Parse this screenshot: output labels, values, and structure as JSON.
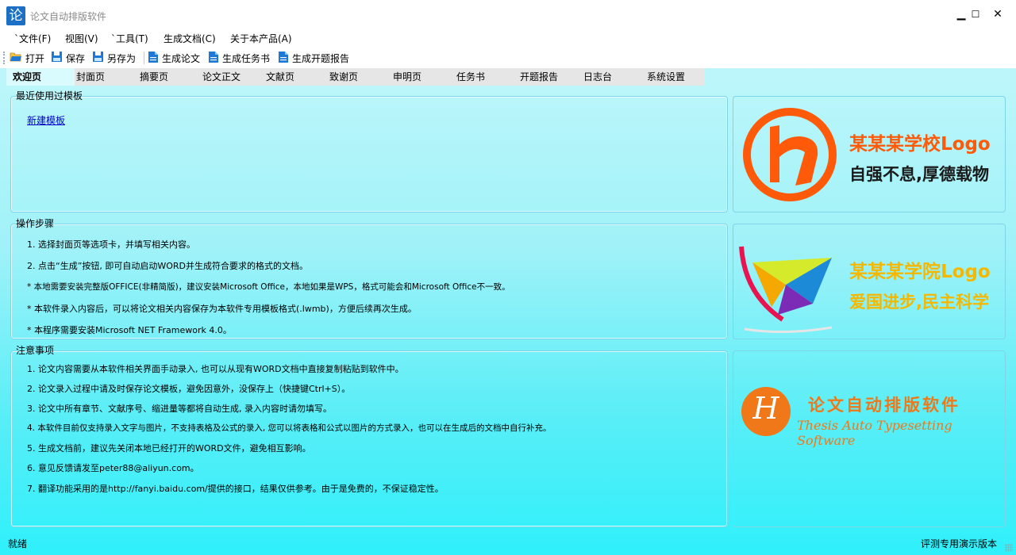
{
  "window": {
    "title": "论文自动排版软件",
    "icon_glyph": "论",
    "icon_color": "#1b6fc4",
    "controls": {
      "minimize": "▁",
      "maximize": "☐",
      "close": "✕"
    }
  },
  "menubar": {
    "items": [
      "`文件(F)",
      "视图(V)",
      "`工具(T)",
      "生成文档(C)",
      "关于本产品(A)"
    ]
  },
  "toolbar": {
    "buttons": [
      {
        "label": "打开",
        "icon": "folder-open-icon"
      },
      {
        "label": "保存",
        "icon": "save-icon"
      },
      {
        "label": "另存为",
        "icon": "save-as-icon"
      },
      {
        "label": "生成论文",
        "icon": "document-icon"
      },
      {
        "label": "生成任务书",
        "icon": "document-icon"
      },
      {
        "label": "生成开题报告",
        "icon": "document-icon"
      }
    ]
  },
  "tabs": [
    "欢迎页",
    "封面页",
    "摘要页",
    "论文正文",
    "文献页",
    "致谢页",
    "申明页",
    "任务书",
    "开题报告",
    "日志台",
    "系统设置"
  ],
  "active_tab": "欢迎页",
  "recent_templates": {
    "title": "最近使用过模板",
    "new_template_link": "新建模板"
  },
  "steps": {
    "title": "操作步骤",
    "items": [
      "1. 选择封面页等选项卡，并填写相关内容。",
      "2. 点击“生成”按钮, 即可自动启动WORD并生成符合要求的格式的文档。",
      "* 本地需要安装完整版OFFICE(非精简版)，建议安装Microsoft Office，本地如果是WPS，格式可能会和Microsoft Office不一致。",
      "* 本软件录入内容后，可以将论文相关内容保存为本软件专用模板格式(.lwmb)，方便后续再次生成。",
      "* 本程序需要安装Microsoft NET Framework 4.0。"
    ]
  },
  "notes": {
    "title": "注意事项",
    "items": [
      "1. 论文内容需要从本软件相关界面手动录入, 也可以从现有WORD文档中直接复制粘贴到软件中。",
      "2. 论文录入过程中请及时保存论文模板，避免因意外，没保存上（快捷键Ctrl+S）。",
      "3. 论文中所有章节、文献序号、缩进量等都将自动生成, 录入内容时请勿填写。",
      "4. 本软件目前仅支持录入文字与图片，不支持表格及公式的录入, 您可以将表格和公式以图片的方式录入，也可以在生成后的文档中自行补充。",
      "5. 生成文档前，建议先关闭本地已经打开的WORD文件，避免相互影响。",
      "6. 意见反馈请发至peter88@aliyun.com。",
      "7. 翻译功能采用的是http://fanyi.baidu.com/提供的接口，结果仅供参考。由于是免费的，不保证稳定性。"
    ]
  },
  "logos": {
    "school": {
      "name": "某某某学校Logo",
      "motto": "自强不息,厚德载物",
      "color": "#ff5a0a"
    },
    "college": {
      "name": "某某某学院Logo",
      "motto": "爱国进步,民主科学",
      "color": "#f5b800"
    },
    "software": {
      "name": "论文自动排版软件",
      "english": "Thesis Auto Typesetting Software",
      "letter": "H",
      "color": "#f07818"
    }
  },
  "status": {
    "left": "就绪",
    "right": "评测专用演示版本"
  }
}
